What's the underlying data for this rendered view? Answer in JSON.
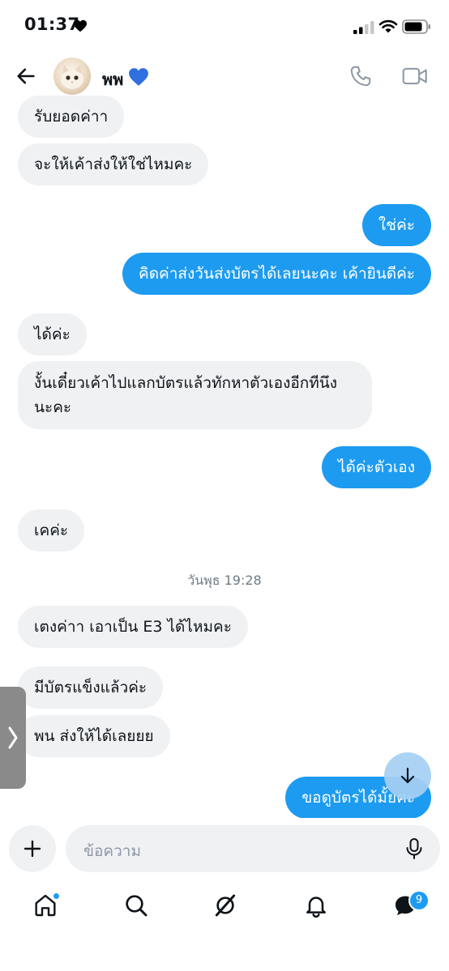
{
  "status_bar": {
    "time": "01:37"
  },
  "header": {
    "contact_name": "พพ"
  },
  "messages": [
    {
      "side": "in",
      "text": "รับยอดค่าา"
    },
    {
      "side": "in",
      "text": "จะให้เค้าส่งให้ใช่ไหมคะ"
    },
    {
      "side": "out",
      "text": "ใช่ค่ะ"
    },
    {
      "side": "out",
      "text": "คิดค่าส่งวันส่งบัตรได้เลยนะคะ เค้ายินดีค่ะ"
    },
    {
      "side": "in",
      "text": "ได้ค่ะ"
    },
    {
      "side": "in",
      "text": "งั้นเดี๋ยวเค้าไปแลกบัตรแล้วทักหาตัวเองอีกทีนึงนะคะ"
    },
    {
      "side": "out",
      "text": "ได้ค่ะตัวเอง"
    },
    {
      "side": "in",
      "text": "เคค่ะ"
    },
    {
      "side": "in",
      "text": "เตงค่าา เอาเป็น E3 ได้ไหมคะ"
    },
    {
      "side": "in",
      "text": "มีบัตรแข็งแล้วค่ะ"
    },
    {
      "side": "in",
      "text": "พน ส่งให้ได้เลยยย"
    },
    {
      "side": "out",
      "text": "ขอดูบัตรได้มั้ยคะ"
    }
  ],
  "date_separator": "วันพุธ 19:28",
  "composer": {
    "placeholder": "ข้อความ"
  },
  "nav": {
    "messages_badge": "9"
  },
  "colors": {
    "accent": "#1d9bf0",
    "incoming_bubble": "#eff1f3"
  },
  "icons": [
    "back-arrow-icon",
    "phone-icon",
    "video-icon",
    "plus-icon",
    "mic-icon",
    "home-icon",
    "search-icon",
    "grok-icon",
    "bell-icon",
    "messages-icon",
    "arrow-down-icon"
  ]
}
